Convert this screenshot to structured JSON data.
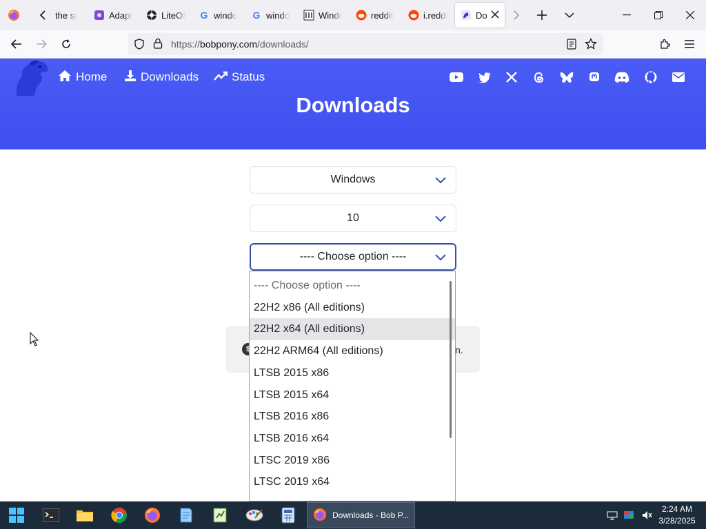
{
  "browser": {
    "tabs": [
      {
        "title": "the si",
        "icon": "back-arrow-tab"
      },
      {
        "title": "Adapt",
        "icon": "adapt-favicon"
      },
      {
        "title": "LiteOS",
        "icon": "liteos-favicon"
      },
      {
        "title": "windo",
        "icon": "google-favicon"
      },
      {
        "title": "windo",
        "icon": "google-favicon"
      },
      {
        "title": "Windo",
        "icon": "wikipedia-favicon"
      },
      {
        "title": "reddit",
        "icon": "reddit-favicon"
      },
      {
        "title": "i.reddi",
        "icon": "reddit-favicon"
      },
      {
        "title": "Do",
        "icon": "bobpony-favicon",
        "active": true
      }
    ],
    "url": {
      "scheme": "https://",
      "host": "bobpony.com",
      "path": "/downloads/"
    }
  },
  "site": {
    "nav": {
      "home": "Home",
      "downloads": "Downloads",
      "status": "Status"
    },
    "social_icons": [
      "youtube-icon",
      "twitter-icon",
      "x-icon",
      "threads-icon",
      "bluesky-icon",
      "mastodon-icon",
      "discord-icon",
      "github-icon",
      "email-icon"
    ],
    "page_title": "Downloads",
    "colors": {
      "header": "#4150f3",
      "select_focus": "#3452a3"
    }
  },
  "selects": {
    "os": "Windows",
    "version": "10",
    "build": "---- Choose option ----"
  },
  "dropdown": {
    "options": [
      "---- Choose option ----",
      "22H2 x86 (All editions)",
      "22H2 x64 (All editions)",
      "22H2 ARM64 (All editions)",
      "LTSB 2015 x86",
      "LTSB 2015 x64",
      "LTSB 2016 x86",
      "LTSB 2016 x64",
      "LTSC 2019 x86",
      "LTSC 2019 x64"
    ],
    "hovered_index": 2
  },
  "alert": {
    "icon_glyph": "$",
    "text_tail": "n."
  },
  "taskbar": {
    "active_window": "Downloads - Bob P...",
    "time": "2:24 AM",
    "date": "3/28/2025"
  }
}
